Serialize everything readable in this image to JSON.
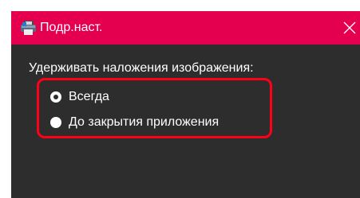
{
  "window": {
    "title": "Подр.наст.",
    "title_bar_color": "#e5004f",
    "background_color": "#2d2d2d",
    "icon": "printer-app-icon",
    "close_icon": "close-icon"
  },
  "settings": {
    "group_label": "Удерживать наложения изображения:",
    "highlight_color": "#ff0016",
    "options": [
      {
        "label": "Всегда",
        "selected": true
      },
      {
        "label": "До закрытия приложения",
        "selected": false
      }
    ]
  }
}
